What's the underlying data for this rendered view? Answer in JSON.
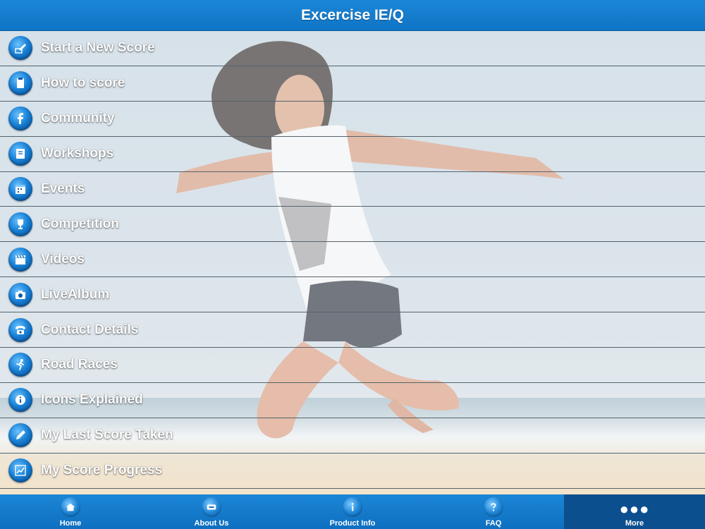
{
  "header": {
    "title": "Excercise IE/Q"
  },
  "menu": {
    "items": [
      {
        "label": "Start a New Score",
        "icon": "pencil-score-icon"
      },
      {
        "label": "How to score",
        "icon": "clipboard-icon"
      },
      {
        "label": "Community",
        "icon": "facebook-icon"
      },
      {
        "label": "Workshops",
        "icon": "notebook-icon"
      },
      {
        "label": "Events",
        "icon": "calendar-icon"
      },
      {
        "label": "Competition",
        "icon": "trophy-icon"
      },
      {
        "label": "Videos",
        "icon": "clapperboard-icon"
      },
      {
        "label": "LiveAlbum",
        "icon": "camera-icon"
      },
      {
        "label": "Contact Details",
        "icon": "phone-icon"
      },
      {
        "label": "Road Races",
        "icon": "runner-icon"
      },
      {
        "label": "Icons Explained",
        "icon": "info-icon"
      },
      {
        "label": "My Last Score Taken",
        "icon": "pen-icon"
      },
      {
        "label": "My Score Progress",
        "icon": "chart-icon"
      }
    ]
  },
  "tabbar": {
    "tabs": [
      {
        "label": "Home",
        "icon": "home-icon"
      },
      {
        "label": "About Us",
        "icon": "about-icon"
      },
      {
        "label": "Product Info",
        "icon": "info-icon"
      },
      {
        "label": "FAQ",
        "icon": "question-icon"
      },
      {
        "label": "More",
        "icon": "more-dots-icon",
        "active": true
      }
    ]
  },
  "colors": {
    "header": "#0f74c5",
    "tab_active": "#0b4f8f",
    "divider": "#55636b"
  }
}
